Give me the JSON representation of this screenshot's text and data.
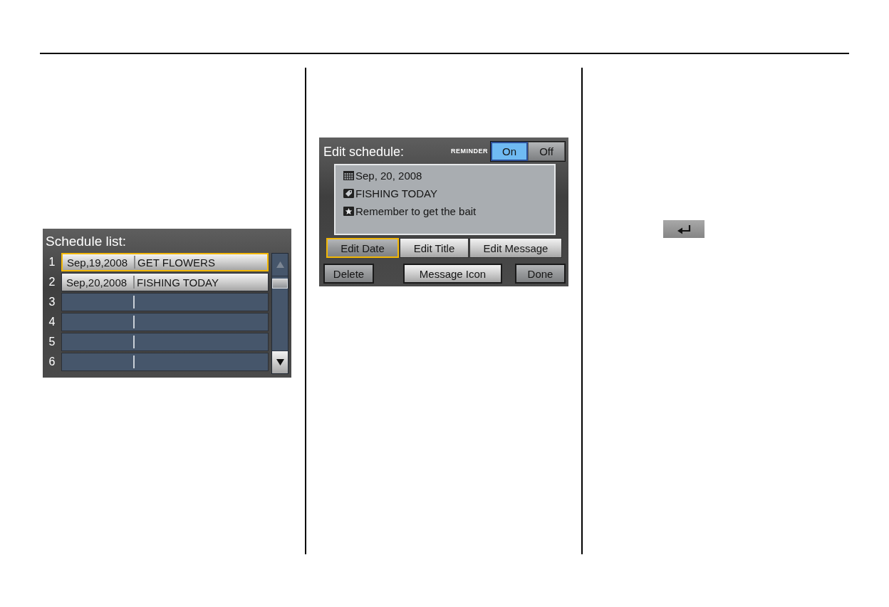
{
  "schedule_list": {
    "title": "Schedule list:",
    "rows": [
      {
        "number": "1",
        "kind": "entry",
        "date": "Sep,19,2008",
        "title": "GET FLOWERS",
        "selected": true
      },
      {
        "number": "2",
        "kind": "entry",
        "date": "Sep,20,2008",
        "title": "FISHING TODAY",
        "selected": false
      },
      {
        "number": "3",
        "kind": "empty",
        "selected": false
      },
      {
        "number": "4",
        "kind": "empty",
        "selected": false
      },
      {
        "number": "5",
        "kind": "empty",
        "selected": false
      },
      {
        "number": "6",
        "kind": "empty",
        "selected": false
      }
    ]
  },
  "edit_schedule": {
    "title": "Edit schedule:",
    "reminder": {
      "label": "REMINDER",
      "options": [
        {
          "label": "On",
          "selected": true
        },
        {
          "label": "Off",
          "selected": false
        }
      ]
    },
    "details": [
      {
        "kind": "date",
        "text": "Sep, 20, 2008"
      },
      {
        "kind": "title",
        "text": "FISHING TODAY"
      },
      {
        "kind": "message",
        "text": "Remember to get the bait"
      }
    ],
    "edit_buttons": [
      {
        "label": "Edit Date",
        "selected": true
      },
      {
        "label": "Edit Title",
        "selected": false
      },
      {
        "label": "Edit Message",
        "selected": false
      }
    ],
    "action_buttons": [
      "Delete",
      "Message Icon",
      "Done"
    ]
  }
}
